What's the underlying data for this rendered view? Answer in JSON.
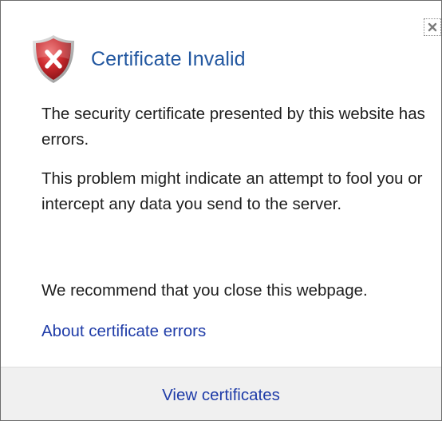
{
  "dialog": {
    "title": "Certificate Invalid",
    "paragraphs": [
      "The security certificate presented by this website has errors.",
      "This problem might indicate an attempt to fool you or intercept any data you send to the server.",
      "We recommend that you close this webpage."
    ],
    "about_link": "About certificate errors",
    "footer_link": "View certificates",
    "close_icon": "close-icon",
    "shield_icon": "shield-error-icon"
  },
  "colors": {
    "title": "#2257a0",
    "link": "#1f3ca8",
    "shield": "#c0262c",
    "footer_bg": "#f0f0f0"
  }
}
